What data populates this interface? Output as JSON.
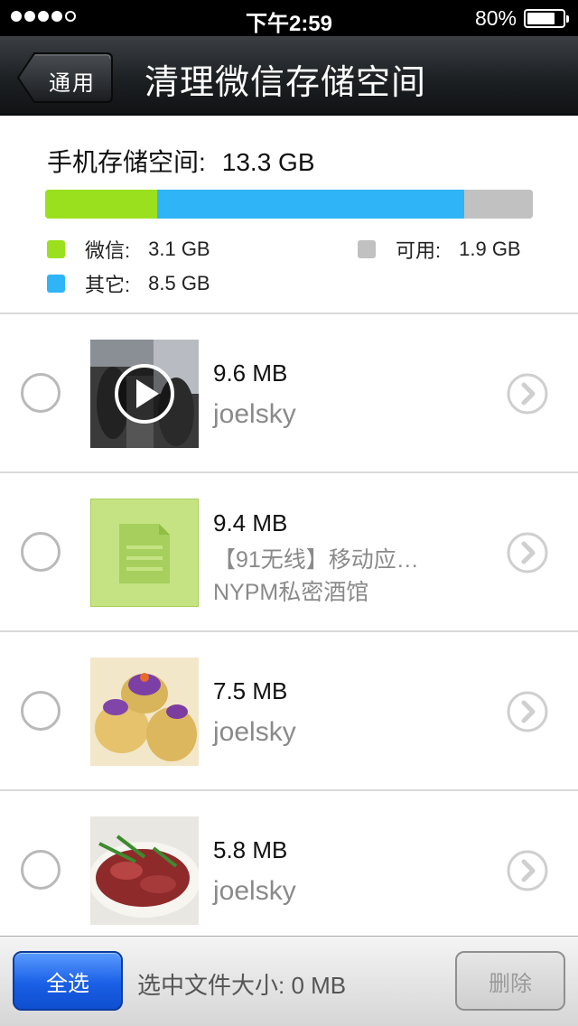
{
  "status_bar": {
    "time": "下午2:59",
    "battery_percent": "80%",
    "battery_level": 0.8,
    "signal_bars": 4,
    "signal_total": 5
  },
  "nav": {
    "back_label": "通用",
    "title": "清理微信存储空间"
  },
  "storage": {
    "label": "手机存储空间:",
    "total": "13.3 GB",
    "segments": [
      {
        "name": "wechat",
        "value_gb": 3.1,
        "color": "#9be01e"
      },
      {
        "name": "other",
        "value_gb": 8.5,
        "color": "#2fb4f7"
      },
      {
        "name": "free",
        "value_gb": 1.9,
        "color": "#c1c1c1"
      }
    ],
    "legend": {
      "wechat_label": "微信:",
      "wechat_value": "3.1 GB",
      "other_label": "其它:",
      "other_value": "8.5 GB",
      "free_label": "可用:",
      "free_value": "1.9 GB"
    }
  },
  "files": [
    {
      "size": "9.6 MB",
      "sender": "joelsky",
      "thumbnail": "video-thumbnail",
      "selected": false
    },
    {
      "size": "9.4 MB",
      "title": "【91无线】移动应…",
      "sender": "NYPM私密酒馆",
      "thumbnail": "document-icon",
      "selected": false
    },
    {
      "size": "7.5 MB",
      "sender": "joelsky",
      "thumbnail": "food-photo-pastry",
      "selected": false
    },
    {
      "size": "5.8 MB",
      "sender": "joelsky",
      "thumbnail": "food-photo-steak",
      "selected": false
    }
  ],
  "toolbar": {
    "select_all_label": "全选",
    "selected_size_label": "选中文件大小: 0 MB",
    "delete_label": "删除"
  },
  "colors": {
    "accent_blue": "#1a5fe6",
    "wechat_green": "#9be01e",
    "other_blue": "#2fb4f7",
    "free_gray": "#c1c1c1"
  }
}
